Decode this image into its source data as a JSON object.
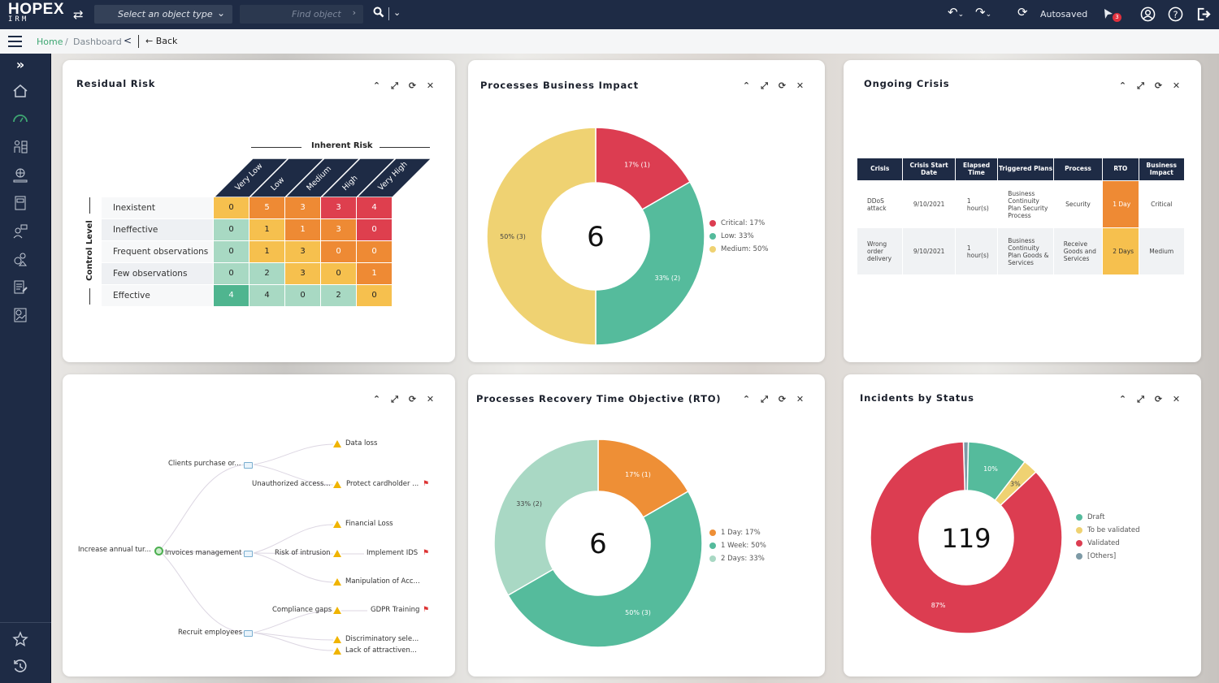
{
  "topbar": {
    "logo_main": "HOPEX",
    "logo_sub": "IRM",
    "object_type_placeholder": "Select an object type",
    "find_placeholder": "Find object",
    "autosaved": "Autosaved",
    "notification_count": "3",
    "icons": [
      "swap-icon",
      "search-icon",
      "undo-icon",
      "redo-icon",
      "refresh-icon",
      "notification-icon",
      "user-icon",
      "help-icon",
      "logout-icon"
    ]
  },
  "breadcrumb": {
    "home": "Home",
    "separator": "/",
    "current": "Dashboard",
    "back": "Back"
  },
  "sidebar": {
    "items": [
      "expand",
      "home",
      "dashboard",
      "organization",
      "global-risk",
      "library",
      "assessment",
      "controls",
      "reports",
      "analytics"
    ],
    "bottom": [
      "favorites",
      "history"
    ],
    "active": "dashboard",
    "active_color": "#3ea772"
  },
  "panels": {
    "residual_risk": {
      "title": "Residual Risk",
      "x_axis_title": "Inherent Risk",
      "y_axis_title": "Control Level",
      "columns": [
        "Very Low",
        "Low",
        "Medium",
        "High",
        "Very High"
      ],
      "rows": [
        {
          "label": "Inexistent",
          "values": [
            0,
            5,
            3,
            3,
            4
          ],
          "colors": [
            "#f6c04e",
            "#ee8a34",
            "#ee8a34",
            "#de3f4e",
            "#de3f4e"
          ]
        },
        {
          "label": "Ineffective",
          "values": [
            0,
            1,
            1,
            3,
            0
          ],
          "colors": [
            "#a8d9c3",
            "#f6c04e",
            "#ee8a34",
            "#ee8a34",
            "#de3f4e"
          ]
        },
        {
          "label": "Frequent observations",
          "values": [
            0,
            1,
            3,
            0,
            0
          ],
          "colors": [
            "#a8d9c3",
            "#f6c04e",
            "#f6c04e",
            "#ee8a34",
            "#ee8a34"
          ]
        },
        {
          "label": "Few observations",
          "values": [
            0,
            2,
            3,
            0,
            1
          ],
          "colors": [
            "#a8d9c3",
            "#a8d9c3",
            "#f6c04e",
            "#f6c04e",
            "#ee8a34"
          ]
        },
        {
          "label": "Effective",
          "values": [
            4,
            4,
            0,
            2,
            0
          ],
          "colors": [
            "#4fb58f",
            "#a8d9c3",
            "#a8d9c3",
            "#a8d9c3",
            "#f6c04e"
          ]
        }
      ]
    },
    "business_impact": {
      "title": "Processes Business Impact",
      "total": "6"
    },
    "ongoing_crisis": {
      "title": "Ongoing Crisis",
      "headers": [
        "Crisis",
        "Crisis Start Date",
        "Elapsed Time",
        "Triggered Plans",
        "Process",
        "RTO",
        "Business Impact"
      ],
      "rows": [
        {
          "crisis": "DDoS attack",
          "start": "9/10/2021",
          "elapsed": "1 hour(s)",
          "plans": "Business Continuity Plan Security Process",
          "process": "Security",
          "rto": "1 Day",
          "rto_color": "#ee8a34",
          "impact": "Critical"
        },
        {
          "crisis": "Wrong order delivery",
          "start": "9/10/2021",
          "elapsed": "1 hour(s)",
          "plans": "Business Continuity Plan Goods & Services",
          "process": "Receive Goods and Services",
          "rto": "2 Days",
          "rto_color": "#f6c04e",
          "impact": "Medium"
        }
      ]
    },
    "risk_tree": {
      "nodes": {
        "root": "Increase annual tur...",
        "p1": "Clients purchase or...",
        "p2": "Invoices management",
        "p3": "Recruit employees",
        "r1": "Data loss",
        "r2": "Unauthorized access...",
        "r3": "Financial Loss",
        "r4": "Risk of intrusion",
        "r5": "Manipulation of Acc...",
        "r6": "Compliance gaps",
        "r7": "Discriminatory sele...",
        "r8": "Lack of attractiven...",
        "a1": "Protect cardholder ...",
        "a2": "Implement IDS",
        "a3": "GDPR Training"
      }
    },
    "rto": {
      "title": "Processes Recovery Time Objective (RTO)",
      "total": "6"
    },
    "incidents": {
      "title": "Incidents by Status",
      "total": "119"
    },
    "controls": [
      "collapse",
      "maximize",
      "refresh",
      "close"
    ]
  },
  "chart_data": [
    {
      "type": "pie",
      "title": "Processes Business Impact",
      "center_label": "6",
      "legend_position": "right",
      "slices": [
        {
          "name": "Critical",
          "value": 1,
          "percent": 17,
          "label": "17% (1)",
          "legend": "Critical: 17%",
          "color": "#dc3d51"
        },
        {
          "name": "Low",
          "value": 2,
          "percent": 33,
          "label": "33% (2)",
          "legend": "Low: 33%",
          "color": "#55bb9c"
        },
        {
          "name": "Medium",
          "value": 3,
          "percent": 50,
          "label": "50% (3)",
          "legend": "Medium: 50%",
          "color": "#efd272"
        }
      ]
    },
    {
      "type": "pie",
      "title": "Processes Recovery Time Objective (RTO)",
      "center_label": "6",
      "legend_position": "right",
      "slices": [
        {
          "name": "1 Day",
          "value": 1,
          "percent": 17,
          "label": "17% (1)",
          "legend": "1 Day: 17%",
          "color": "#ee8f36"
        },
        {
          "name": "1 Week",
          "value": 3,
          "percent": 50,
          "label": "50% (3)",
          "legend": "1 Week: 50%",
          "color": "#55bb9c"
        },
        {
          "name": "2 Days",
          "value": 2,
          "percent": 33,
          "label": "33% (2)",
          "legend": "2 Days: 33%",
          "color": "#a9d8c4"
        }
      ]
    },
    {
      "type": "pie",
      "title": "Incidents by Status",
      "center_label": "119",
      "legend_position": "right",
      "slices": [
        {
          "name": "[Others]",
          "value": 1,
          "percent": 0.8,
          "label": "",
          "legend": "[Others]",
          "color": "#7d9aa6"
        },
        {
          "name": "Draft",
          "value": 12,
          "percent": 10,
          "label": "10%",
          "legend": "Draft",
          "color": "#55bb9c"
        },
        {
          "name": "To be validated",
          "value": 3,
          "percent": 3,
          "label": "3%",
          "legend": "To be validated",
          "color": "#efd272"
        },
        {
          "name": "Validated",
          "value": 103,
          "percent": 87,
          "label": "87%",
          "legend": "Validated",
          "color": "#dc3d51"
        }
      ],
      "legend_order": [
        "Draft",
        "To be validated",
        "Validated",
        "[Others]"
      ]
    }
  ]
}
